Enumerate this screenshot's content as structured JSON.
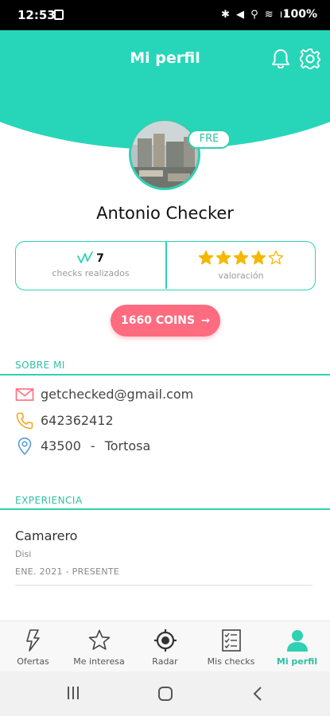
{
  "status_bar": {
    "time": "12:53",
    "system_icons": "✱ ◀ ⚲ ≋ ıl",
    "battery": "100%"
  },
  "header": {
    "title": "Mi perfil",
    "bell_icon": "bell-icon",
    "settings_icon": "gear-icon",
    "color": "#27d6b8"
  },
  "profile": {
    "badge": "FRE",
    "name": "Antonio Checker",
    "checks_count": "7",
    "checks_label": "checks realizados",
    "rating_label": "valoración",
    "rating_value": 4,
    "rating_max": 5,
    "coins_label": "1660 COINS",
    "coins_arrow": "→"
  },
  "about": {
    "title": "SOBRE MI",
    "email": "getchecked@gmail.com",
    "phone": "642362412",
    "postal_code": "43500",
    "separator": "-",
    "city": "Tortosa"
  },
  "experience": {
    "title": "EXPERIENCIA",
    "items": [
      {
        "role": "Camarero",
        "company": "Disi",
        "dates": "ENE. 2021 - PRESENTE"
      }
    ]
  },
  "tabs": [
    {
      "label": "Ofertas",
      "icon": "lightning-icon",
      "active": false
    },
    {
      "label": "Me interesa",
      "icon": "star-icon",
      "active": false
    },
    {
      "label": "Radar",
      "icon": "radar-icon",
      "active": false
    },
    {
      "label": "Mis checks",
      "icon": "checklist-icon",
      "active": false
    },
    {
      "label": "Mi perfil",
      "icon": "user-icon",
      "active": true
    }
  ],
  "colors": {
    "accent": "#2fd1b3",
    "coins": "#ff6b7f",
    "star": "#f5b800"
  }
}
